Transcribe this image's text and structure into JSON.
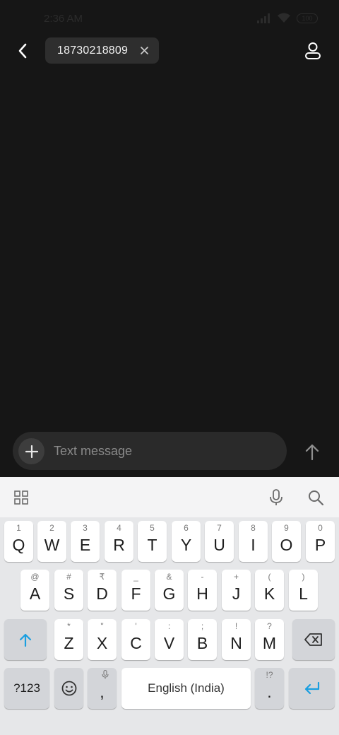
{
  "status_bar": {
    "time": "2:36 AM",
    "battery": "100",
    "icons": [
      "signal-icon",
      "wifi-icon",
      "battery-icon"
    ]
  },
  "header": {
    "back_icon": "chevron-left-icon",
    "recipient": "18730218809",
    "remove_icon": "close-icon",
    "contact_icon": "person-icon"
  },
  "compose": {
    "placeholder": "Text message",
    "value": "",
    "add_icon": "plus-icon",
    "send_icon": "arrow-up-icon"
  },
  "keyboard": {
    "toolbar": [
      "apps-grid-icon",
      "microphone-icon",
      "search-icon"
    ],
    "row1": [
      {
        "key": "Q",
        "hint": "1"
      },
      {
        "key": "W",
        "hint": "2"
      },
      {
        "key": "E",
        "hint": "3"
      },
      {
        "key": "R",
        "hint": "4"
      },
      {
        "key": "T",
        "hint": "5"
      },
      {
        "key": "Y",
        "hint": "6"
      },
      {
        "key": "U",
        "hint": "7"
      },
      {
        "key": "I",
        "hint": "8"
      },
      {
        "key": "O",
        "hint": "9"
      },
      {
        "key": "P",
        "hint": "0"
      }
    ],
    "row2": [
      {
        "key": "A",
        "hint": "@"
      },
      {
        "key": "S",
        "hint": "#"
      },
      {
        "key": "D",
        "hint": "₹"
      },
      {
        "key": "F",
        "hint": "_"
      },
      {
        "key": "G",
        "hint": "&"
      },
      {
        "key": "H",
        "hint": "-"
      },
      {
        "key": "J",
        "hint": "+"
      },
      {
        "key": "K",
        "hint": "("
      },
      {
        "key": "L",
        "hint": ")"
      }
    ],
    "row3": [
      {
        "key": "Z",
        "hint": "*"
      },
      {
        "key": "X",
        "hint": "\""
      },
      {
        "key": "C",
        "hint": "'"
      },
      {
        "key": "V",
        "hint": ":"
      },
      {
        "key": "B",
        "hint": ";"
      },
      {
        "key": "N",
        "hint": "!"
      },
      {
        "key": "M",
        "hint": "?"
      }
    ],
    "shift_icon": "shift-arrow-icon",
    "backspace_icon": "backspace-icon",
    "symbols_label": "?123",
    "emoji_icon": "emoji-icon",
    "comma_label": ",",
    "comma_hint_icon": "microphone-icon",
    "space_label": "English (India)",
    "period_label": ".",
    "period_hint": "!?",
    "enter_icon": "enter-icon",
    "accent_color": "#1a9fe0"
  }
}
